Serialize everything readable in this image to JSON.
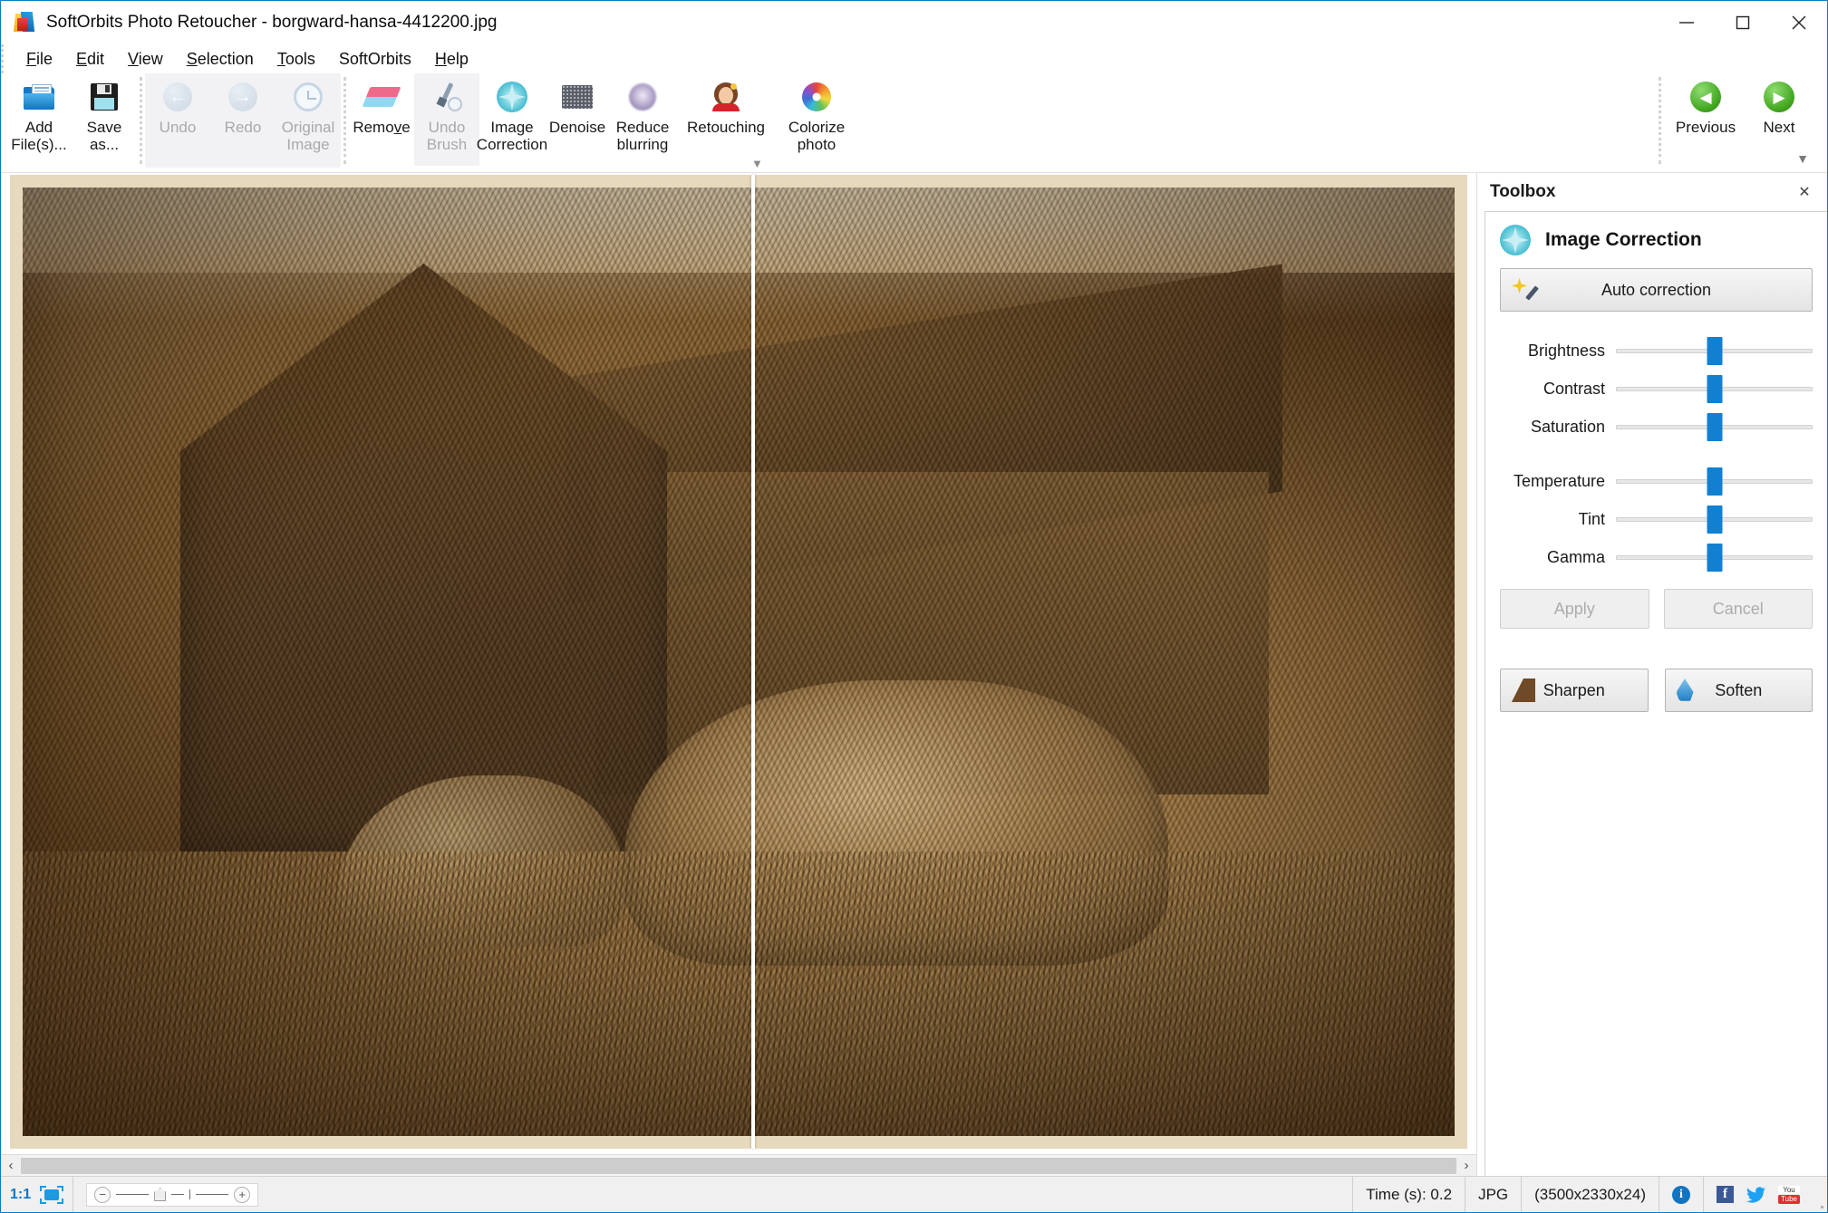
{
  "window": {
    "title": "SoftOrbits Photo Retoucher - borgward-hansa-4412200.jpg",
    "app_icon": "softorbits-logo-icon",
    "minimize_label": "Minimize",
    "maximize_label": "Maximize",
    "close_label": "Close"
  },
  "menubar": {
    "items": [
      {
        "label": "File",
        "accel": "F"
      },
      {
        "label": "Edit",
        "accel": "E"
      },
      {
        "label": "View",
        "accel": "V"
      },
      {
        "label": "Selection",
        "accel": "S"
      },
      {
        "label": "Tools",
        "accel": "T"
      },
      {
        "label": "SoftOrbits",
        "accel": ""
      },
      {
        "label": "Help",
        "accel": "H"
      }
    ]
  },
  "ribbon": {
    "add_files": {
      "label": "Add\nFile(s)...",
      "icon": "open-folder-icon",
      "enabled": true
    },
    "save_as": {
      "label": "Save\nas...",
      "icon": "floppy-disk-icon",
      "enabled": true
    },
    "undo": {
      "label": "Undo",
      "icon": "arrow-left-circle-icon",
      "enabled": false
    },
    "redo": {
      "label": "Redo",
      "icon": "arrow-right-circle-icon",
      "enabled": false
    },
    "original_image": {
      "label": "Original\nImage",
      "icon": "clock-revert-icon",
      "enabled": false
    },
    "remove": {
      "label": "Remove",
      "icon": "eraser-icon",
      "enabled": true
    },
    "undo_brush": {
      "label": "Undo\nBrush",
      "icon": "brush-clock-icon",
      "enabled": false
    },
    "image_correction": {
      "label": "Image\nCorrection",
      "icon": "sparkle-circle-icon",
      "enabled": true
    },
    "denoise": {
      "label": "Denoise",
      "icon": "noise-grid-icon",
      "enabled": true
    },
    "reduce_blurring": {
      "label": "Reduce\nblurring",
      "icon": "blur-sphere-icon",
      "enabled": true
    },
    "retouching": {
      "label": "Retouching",
      "icon": "face-portrait-icon",
      "enabled": true
    },
    "colorize_photo": {
      "label": "Colorize\nphoto",
      "icon": "color-wheel-icon",
      "enabled": true
    },
    "previous": {
      "label": "Previous",
      "icon": "green-left-arrow-icon",
      "enabled": true
    },
    "next": {
      "label": "Next",
      "icon": "green-right-arrow-icon",
      "enabled": true
    },
    "expander": "▼"
  },
  "canvas": {
    "split_divider": "before-after-divider",
    "scroll_left": "‹",
    "scroll_right": "›"
  },
  "toolbox": {
    "title": "Toolbox",
    "close": "✕",
    "tool_name": "Image Correction",
    "tool_icon": "sparkle-circle-icon",
    "auto_correction": {
      "label": "Auto correction",
      "icon": "magic-wand-icon"
    },
    "sliders": [
      {
        "name": "Brightness",
        "position_pct": 50
      },
      {
        "name": "Contrast",
        "position_pct": 50
      },
      {
        "name": "Saturation",
        "position_pct": 50
      },
      {
        "name": "Temperature",
        "position_pct": 50
      },
      {
        "name": "Tint",
        "position_pct": 50
      },
      {
        "name": "Gamma",
        "position_pct": 50
      }
    ],
    "apply": {
      "label": "Apply",
      "enabled": false
    },
    "cancel": {
      "label": "Cancel",
      "enabled": false
    },
    "sharpen": {
      "label": "Sharpen",
      "icon": "cone-sharpen-icon"
    },
    "soften": {
      "label": "Soften",
      "icon": "water-drop-icon"
    }
  },
  "statusbar": {
    "zoom_ratio": "1:1",
    "fit_icon": "fit-to-window-icon",
    "zoom_out": "−",
    "zoom_in": "+",
    "time": "Time (s): 0.2",
    "format": "JPG",
    "dimensions": "(3500x2330x24)",
    "info_icon": "info-icon",
    "facebook_icon": "facebook-icon",
    "twitter_icon": "twitter-icon",
    "youtube_icon": "youtube-icon",
    "facebook_glyph": "f",
    "twitter_glyph": "🐦",
    "youtube_top": "You",
    "youtube_bottom": "Tube",
    "info_glyph": "i"
  },
  "colors": {
    "accent_blue": "#1180d0",
    "window_border": "#0a7cc4",
    "green_nav": "#43a821",
    "facebook": "#3b5998",
    "twitter": "#1da1f2",
    "youtube": "#e02f2f"
  }
}
